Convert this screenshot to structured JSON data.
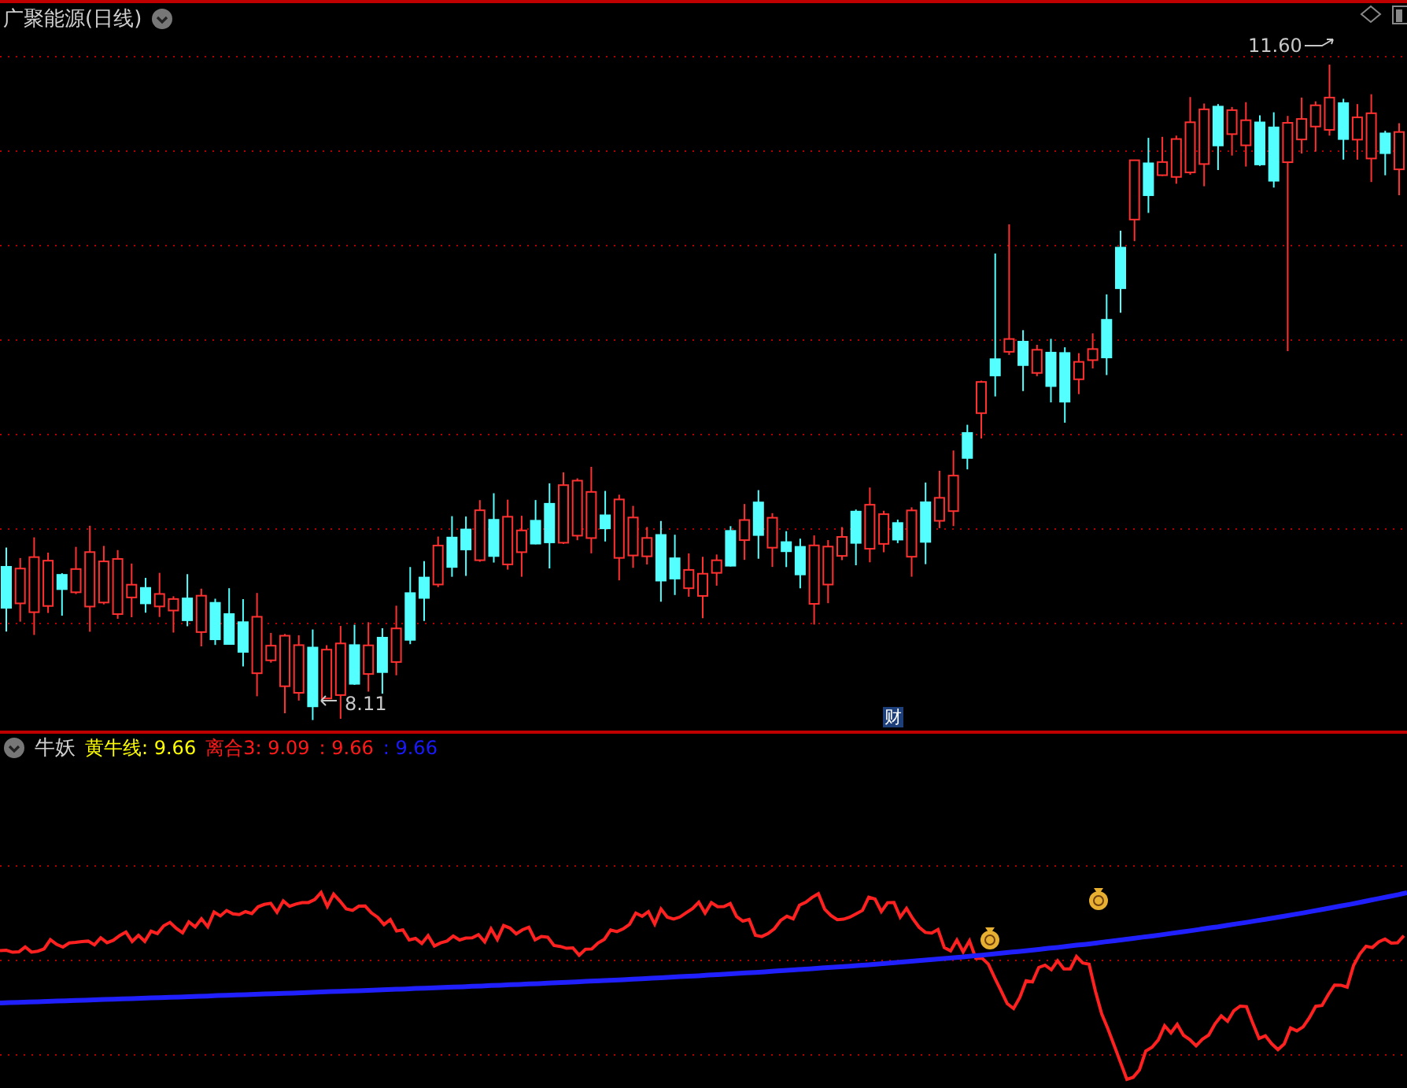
{
  "chart_title": "广聚能源(日线)",
  "price_labels": [
    {
      "kind": "high",
      "text": "11.60"
    },
    {
      "kind": "low",
      "text": "8.11"
    }
  ],
  "badge": "财",
  "indicator": {
    "name": "牛妖",
    "readings": [
      {
        "text": "黄牛线: 9.66",
        "color": "#ffff00"
      },
      {
        "text": "离合3: 9.09",
        "color": "#ff1a1a"
      },
      {
        "text": ": 9.66",
        "color": "#ff1a1a"
      },
      {
        "text": ": 9.66",
        "color": "#1a1aff"
      }
    ]
  }
}
